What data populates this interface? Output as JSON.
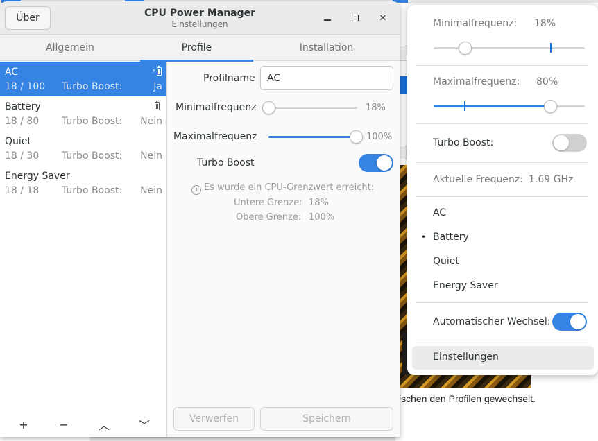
{
  "background": {
    "partial_text": "ischen den Profilen gewechselt."
  },
  "dialog": {
    "about_label": "Über",
    "title": "CPU Power Manager",
    "subtitle": "Einstellungen",
    "tabs": [
      {
        "label": "Allgemein",
        "active": false
      },
      {
        "label": "Profile",
        "active": true
      },
      {
        "label": "Installation",
        "active": false
      }
    ],
    "profiles": [
      {
        "name": "AC",
        "range": "18 / 100",
        "turbo_label": "Turbo Boost:",
        "turbo_value": "Ja",
        "icon": "ac-battery-icon",
        "selected": true
      },
      {
        "name": "Battery",
        "range": "18 / 80",
        "turbo_label": "Turbo Boost:",
        "turbo_value": "Nein",
        "icon": "battery-icon",
        "selected": false
      },
      {
        "name": "Quiet",
        "range": "18 / 30",
        "turbo_label": "Turbo Boost:",
        "turbo_value": "Nein",
        "icon": "",
        "selected": false
      },
      {
        "name": "Energy Saver",
        "range": "18 / 18",
        "turbo_label": "Turbo Boost:",
        "turbo_value": "Nein",
        "icon": "",
        "selected": false
      }
    ],
    "list_toolbar": {
      "add": "+",
      "remove": "−",
      "up": "︿",
      "down": "﹀"
    },
    "form": {
      "name_label": "Profilname",
      "name_value": "AC",
      "min_label": "Minimalfrequenz",
      "min_value": "18%",
      "min_fraction": 0.0,
      "max_label": "Maximalfrequenz",
      "max_value": "100%",
      "max_fraction": 1.0,
      "turbo_label": "Turbo Boost",
      "turbo_on": true,
      "info_line": "Es wurde ein CPU-Grenzwert erreicht:",
      "lower_label": "Untere Grenze:",
      "lower_value": "18%",
      "upper_label": "Obere Grenze:",
      "upper_value": "100%",
      "discard_label": "Verwerfen",
      "save_label": "Speichern"
    }
  },
  "popover": {
    "min_label": "Minimalfrequenz:",
    "min_value": "18%",
    "min_fraction": 0.18,
    "min_mark_fraction": 0.8,
    "max_label": "Maximalfrequenz:",
    "max_value": "80%",
    "max_fraction": 0.8,
    "max_mark_fraction": 0.18,
    "turbo_label": "Turbo Boost:",
    "turbo_on": false,
    "freq_label": "Aktuelle Frequenz:",
    "freq_value": "1.69 GHz",
    "profiles": [
      "AC",
      "Battery",
      "Quiet",
      "Energy Saver"
    ],
    "active_profile_index": 1,
    "auto_switch_label": "Automatischer Wechsel:",
    "auto_switch_on": true,
    "settings_label": "Einstellungen"
  },
  "colors": {
    "accent": "#3584e4",
    "headerbar": "#ebebeb"
  }
}
